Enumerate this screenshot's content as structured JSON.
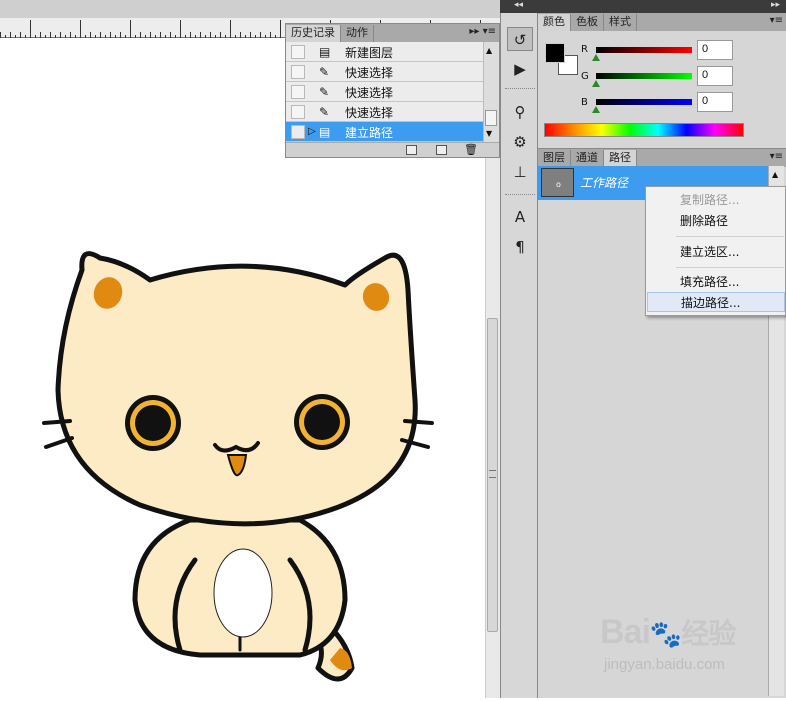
{
  "ruler": {
    "labels": [
      "300",
      "350",
      "400",
      "450",
      "500",
      "5"
    ]
  },
  "history_panel": {
    "tabs": [
      "历史记录",
      "动作"
    ],
    "menu_glyph": "▸▸ ▾≡",
    "items": [
      {
        "label": "新建图层",
        "icon": "new-layer-icon",
        "selected": false
      },
      {
        "label": "快速选择",
        "icon": "quick-select-icon",
        "selected": false
      },
      {
        "label": "快速选择",
        "icon": "quick-select-icon",
        "selected": false
      },
      {
        "label": "快速选择",
        "icon": "quick-select-icon",
        "selected": false
      },
      {
        "label": "建立路径",
        "icon": "make-path-icon",
        "selected": true
      }
    ]
  },
  "color_panel": {
    "tabs": [
      "颜色",
      "色板",
      "样式"
    ],
    "channels": [
      {
        "label": "R",
        "value": "0",
        "color": "#d00000"
      },
      {
        "label": "G",
        "value": "0",
        "color": "#00b000"
      },
      {
        "label": "B",
        "value": "0",
        "color": "#0000c0"
      }
    ],
    "foreground": "#000000",
    "background": "#ffffff"
  },
  "paths_panel": {
    "tabs": [
      "图层",
      "通道",
      "路径"
    ],
    "work_path_label": "工作路径"
  },
  "context_menu": {
    "items": [
      {
        "label": "复制路径...",
        "disabled": true
      },
      {
        "label": "删除路径",
        "disabled": false
      },
      {
        "label": "建立选区...",
        "disabled": false
      },
      {
        "label": "填充路径...",
        "disabled": false
      },
      {
        "label": "描边路径...",
        "disabled": false,
        "hovered": true
      }
    ]
  },
  "watermark": {
    "brand": "Bai",
    "suffix": "经验",
    "url": "jingyan.baidu.com"
  },
  "colors": {
    "selection": "#3d9cf0",
    "cat_body": "#fcebc4",
    "cat_ears": "#e08a12",
    "cat_eyes": "#f2b233"
  }
}
